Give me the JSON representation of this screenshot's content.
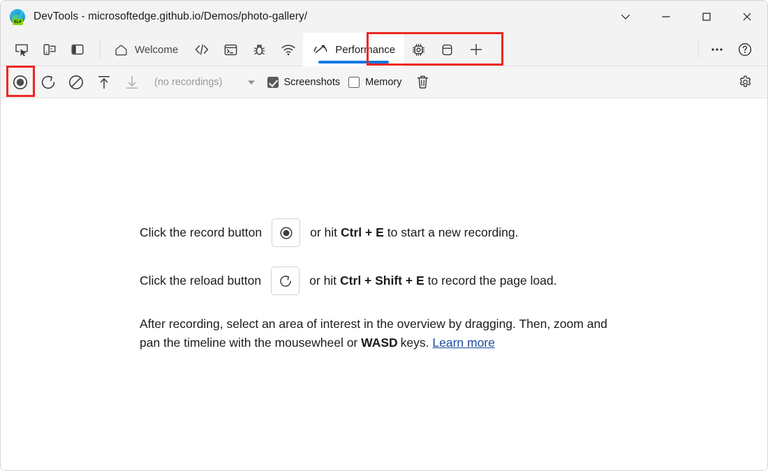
{
  "window": {
    "title": "DevTools - microsoftedge.github.io/Demos/photo-gallery/",
    "app_icon": "edge-devtools-icon",
    "badge_text": "ELF",
    "controls": {
      "more": "chevron-down-icon",
      "minimize": "minimize-icon",
      "maximize": "maximize-icon",
      "close": "close-icon"
    }
  },
  "tabstrip": {
    "tools": [
      {
        "name": "inspect-element-button",
        "icon": "inspect-cursor-icon",
        "label": "Inspect"
      },
      {
        "name": "device-emulation-button",
        "icon": "device-toggle-icon",
        "label": "Toggle device emulation"
      },
      {
        "name": "dock-side-button",
        "icon": "dock-panel-icon",
        "label": "Dock side"
      }
    ],
    "tabs": [
      {
        "name": "tab-welcome",
        "label": "Welcome",
        "icon": "home-icon",
        "active": false,
        "icon_only": false
      },
      {
        "name": "tab-elements",
        "label": "Elements",
        "icon": "code-brackets-icon",
        "active": false,
        "icon_only": true
      },
      {
        "name": "tab-console",
        "label": "Console",
        "icon": "terminal-icon",
        "active": false,
        "icon_only": true
      },
      {
        "name": "tab-sources",
        "label": "Sources",
        "icon": "bug-icon",
        "active": false,
        "icon_only": true
      },
      {
        "name": "tab-network",
        "label": "Network",
        "icon": "wifi-icon",
        "active": false,
        "icon_only": true
      },
      {
        "name": "tab-performance",
        "label": "Performance",
        "icon": "speedometer-icon",
        "active": true,
        "icon_only": false
      },
      {
        "name": "tab-memory",
        "label": "Memory",
        "icon": "cpu-chip-icon",
        "active": false,
        "icon_only": true
      },
      {
        "name": "tab-application",
        "label": "Application",
        "icon": "database-icon",
        "active": false,
        "icon_only": true
      }
    ],
    "add_tab": {
      "name": "add-tab-button",
      "icon": "plus-icon",
      "label": "More tools"
    },
    "more_options": {
      "name": "more-options-button",
      "icon": "ellipsis-icon",
      "label": "Customize and control DevTools"
    },
    "help": {
      "name": "help-button",
      "icon": "question-circle-icon",
      "label": "Help"
    },
    "active_accent_color": "#1277e0"
  },
  "perf_toolbar": {
    "record": {
      "label": "Record",
      "icon": "record-circle-icon"
    },
    "reload": {
      "label": "Record and reload",
      "icon": "reload-circular-arrow-icon"
    },
    "clear": {
      "label": "Clear recording",
      "icon": "circle-slash-icon"
    },
    "upload": {
      "label": "Load profile",
      "icon": "arrow-up-to-line-icon"
    },
    "download": {
      "label": "Save profile",
      "icon": "arrow-down-to-line-icon",
      "disabled": true
    },
    "recordings_value": "(no recordings)",
    "dropdown": {
      "icon": "caret-down-icon"
    },
    "screenshots": {
      "label": "Screenshots",
      "checked": true
    },
    "memory": {
      "label": "Memory",
      "checked": false
    },
    "trash": {
      "label": "Delete recording",
      "icon": "trash-icon"
    },
    "settings": {
      "label": "Capture settings",
      "icon": "gear-icon"
    }
  },
  "callouts": {
    "highlight_color": "#ee2722",
    "items": [
      {
        "name": "callout-performance-tab",
        "target": "tab-performance"
      },
      {
        "name": "callout-record-button",
        "target": "record-button"
      }
    ]
  },
  "panel": {
    "hint_record": {
      "prefix": "Click the record button",
      "middle": "or hit",
      "shortcut": "Ctrl + E",
      "suffix": "to start a new recording.",
      "button_icon": "record-circle-icon"
    },
    "hint_reload": {
      "prefix": "Click the reload button",
      "middle": "or hit",
      "shortcut": "Ctrl + Shift + E",
      "suffix": "to record the page load.",
      "button_icon": "reload-circular-arrow-icon"
    },
    "hint_paragraph": {
      "part1": "After recording, select an area of interest in the overview by dragging. Then, zoom and pan the timeline with the mousewheel or",
      "keys": "WASD",
      "part2": "keys.",
      "link": "Learn more"
    }
  }
}
